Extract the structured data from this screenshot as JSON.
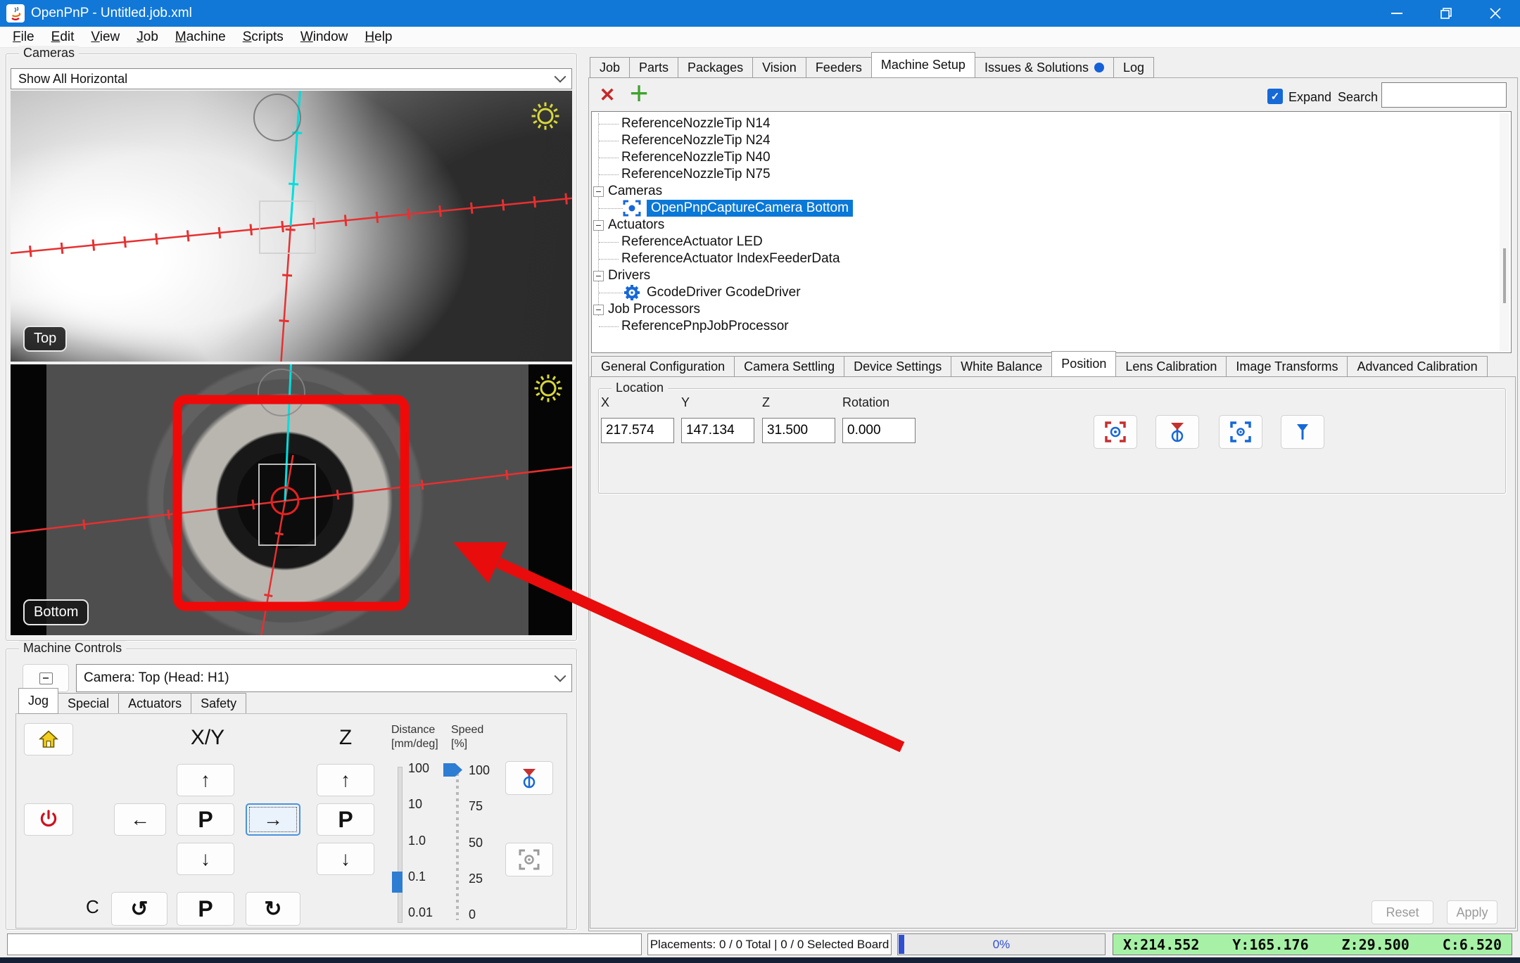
{
  "window": {
    "title": "OpenPnP - Untitled.job.xml"
  },
  "menu": [
    "File",
    "Edit",
    "View",
    "Job",
    "Machine",
    "Scripts",
    "Window",
    "Help"
  ],
  "left": {
    "cameras_group_label": "Cameras",
    "camera_selector_value": "Show All Horizontal",
    "top_view_label": "Top",
    "bottom_view_label": "Bottom",
    "machine_controls_label": "Machine Controls",
    "head_selector_value": "Camera: Top (Head: H1)",
    "control_tabs": [
      {
        "label": "Jog",
        "active": true
      },
      {
        "label": "Special",
        "active": false
      },
      {
        "label": "Actuators",
        "active": false
      },
      {
        "label": "Safety",
        "active": false
      }
    ],
    "jog": {
      "xy_label": "X/Y",
      "z_label": "Z",
      "distance_label": "Distance",
      "distance_unit": "[mm/deg]",
      "speed_label": "Speed",
      "speed_unit": "[%]",
      "distance_ticks": [
        "100",
        "10",
        "1.0",
        "0.1",
        "0.01"
      ],
      "distance_value": "0.1",
      "speed_ticks": [
        "100",
        "75",
        "50",
        "25",
        "0"
      ],
      "speed_value": "100",
      "c_label": "C",
      "p_label": "P",
      "up_glyph": "↑",
      "down_glyph": "↓",
      "left_glyph": "←",
      "right_glyph": "→",
      "ccw_glyph": "↺",
      "cw_glyph": "↻"
    }
  },
  "right": {
    "main_tabs": [
      {
        "label": "Job",
        "active": false
      },
      {
        "label": "Parts",
        "active": false
      },
      {
        "label": "Packages",
        "active": false
      },
      {
        "label": "Vision",
        "active": false
      },
      {
        "label": "Feeders",
        "active": false
      },
      {
        "label": "Machine Setup",
        "active": true
      },
      {
        "label": "Issues & Solutions",
        "active": false,
        "dot": true
      },
      {
        "label": "Log",
        "active": false
      }
    ],
    "toolbar": {
      "delete_glyph": "✕",
      "add_glyph": "+",
      "expand_label": "Expand",
      "expand_checked": true,
      "check_glyph": "✓",
      "search_label": "Search",
      "search_value": ""
    },
    "tree": [
      {
        "label": "ReferenceNozzleTip N14",
        "depth": 2
      },
      {
        "label": "ReferenceNozzleTip N24",
        "depth": 2
      },
      {
        "label": "ReferenceNozzleTip N40",
        "depth": 2
      },
      {
        "label": "ReferenceNozzleTip N75",
        "depth": 2
      },
      {
        "label": "Cameras",
        "depth": 1,
        "expander": true
      },
      {
        "label": "OpenPnpCaptureCamera Bottom",
        "depth": 2,
        "icon": "camera",
        "selected": true
      },
      {
        "label": "Actuators",
        "depth": 1,
        "expander": true
      },
      {
        "label": "ReferenceActuator LED",
        "depth": 2
      },
      {
        "label": "ReferenceActuator IndexFeederData",
        "depth": 2
      },
      {
        "label": "Drivers",
        "depth": 1,
        "expander": true
      },
      {
        "label": "GcodeDriver GcodeDriver",
        "depth": 2,
        "icon": "gear"
      },
      {
        "label": "Job Processors",
        "depth": 1,
        "expander": true
      },
      {
        "label": "ReferencePnpJobProcessor",
        "depth": 2
      }
    ],
    "config_tabs": [
      {
        "label": "General Configuration",
        "active": false
      },
      {
        "label": "Camera Settling",
        "active": false
      },
      {
        "label": "Device Settings",
        "active": false
      },
      {
        "label": "White Balance",
        "active": false
      },
      {
        "label": "Position",
        "active": true
      },
      {
        "label": "Lens Calibration",
        "active": false
      },
      {
        "label": "Image Transforms",
        "active": false
      },
      {
        "label": "Advanced Calibration",
        "active": false
      }
    ],
    "location": {
      "group_label": "Location",
      "fields": [
        {
          "label": "X",
          "value": "217.574"
        },
        {
          "label": "Y",
          "value": "147.134"
        },
        {
          "label": "Z",
          "value": "31.500"
        },
        {
          "label": "Rotation",
          "value": "0.000"
        }
      ]
    },
    "reset_label": "Reset",
    "apply_label": "Apply"
  },
  "statusbar": {
    "placements": "Placements: 0 / 0 Total | 0 / 0 Selected Board",
    "progress": "0%",
    "dro": {
      "x": "X:214.552",
      "y": "Y:165.176",
      "z": "Z:29.500",
      "c": "C:6.520"
    }
  },
  "colors": {
    "titlebar": "#1178d7",
    "selection_blue": "#0a78d7",
    "icon_blue": "#1668d8",
    "annotation_red": "#e80c0c",
    "crosshair_red": "#e63030",
    "reticle_cyan": "#00dede",
    "dro_green": "#a7f1a7",
    "progress_blue": "#3050d0",
    "add_green": "#3fa32d",
    "delete_red": "#c62828",
    "home_yellow": "#f2cf1e",
    "power_red": "#cf1020",
    "sun_yellow": "#d8d83a"
  }
}
